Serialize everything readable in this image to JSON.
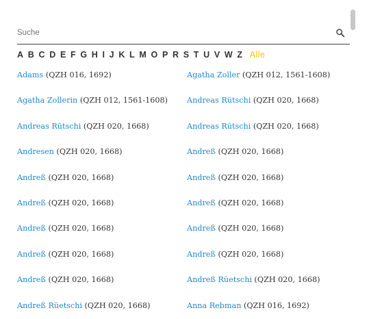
{
  "search": {
    "placeholder": "Suche",
    "value": ""
  },
  "alphabet": {
    "letters": [
      "A",
      "B",
      "C",
      "D",
      "E",
      "F",
      "G",
      "H",
      "I",
      "J",
      "K",
      "L",
      "M",
      "O",
      "P",
      "R",
      "S",
      "T",
      "U",
      "V",
      "W",
      "Z"
    ],
    "all_label": "Alle"
  },
  "entries": [
    [
      {
        "name": "Adams",
        "source": "(QZH 016, 1692)"
      },
      {
        "name": "Agatha Zoller",
        "source": "(QZH 012, 1561-1608)"
      }
    ],
    [
      {
        "name": "Agatha Zollerin",
        "source": "(QZH 012, 1561-1608)"
      },
      {
        "name": "Andreas Rütschi",
        "source": "(QZH 020, 1668)"
      }
    ],
    [
      {
        "name": "Andreas Rütschi",
        "source": "(QZH 020, 1668)"
      },
      {
        "name": "Andreas Rütschi",
        "source": "(QZH 020, 1668)"
      }
    ],
    [
      {
        "name": "Andresen",
        "source": "(QZH 020, 1668)"
      },
      {
        "name": "Andreß",
        "source": "(QZH 020, 1668)"
      }
    ],
    [
      {
        "name": "Andreß",
        "source": "(QZH 020, 1668)"
      },
      {
        "name": "Andreß",
        "source": "(QZH 020, 1668)"
      }
    ],
    [
      {
        "name": "Andreß",
        "source": "(QZH 020, 1668)"
      },
      {
        "name": "Andreß",
        "source": "(QZH 020, 1668)"
      }
    ],
    [
      {
        "name": "Andreß",
        "source": "(QZH 020, 1668)"
      },
      {
        "name": "Andreß",
        "source": "(QZH 020, 1668)"
      }
    ],
    [
      {
        "name": "Andreß",
        "source": "(QZH 020, 1668)"
      },
      {
        "name": "Andreß",
        "source": "(QZH 020, 1668)"
      }
    ],
    [
      {
        "name": "Andreß",
        "source": "(QZH 020, 1668)"
      },
      {
        "name": "Andreß Rüetschi",
        "source": "(QZH 020, 1668)"
      }
    ],
    [
      {
        "name": "Andreß Rüetschi",
        "source": "(QZH 020, 1668)"
      },
      {
        "name": "Anna Rebman",
        "source": "(QZH 016, 1692)"
      }
    ]
  ]
}
